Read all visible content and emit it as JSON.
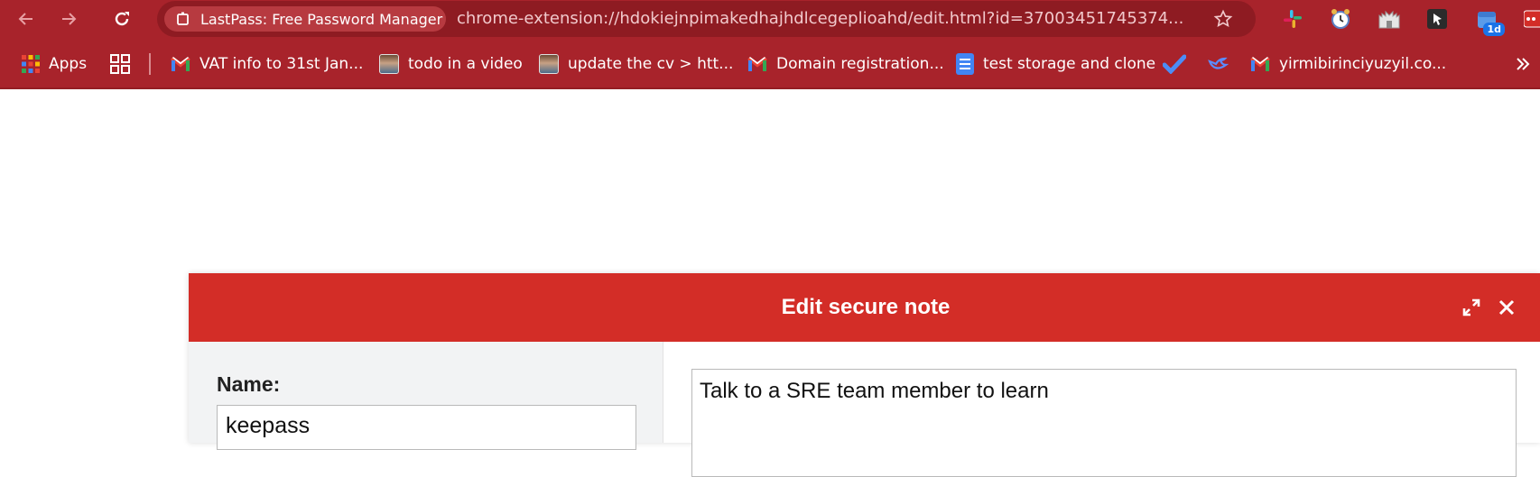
{
  "browser": {
    "site_chip_label": "LastPass: Free Password Manager",
    "url": "chrome-extension://hdokiejnpimakedhajhdlcegeplioahd/edit.html?id=37003451745374...",
    "extensions": [
      {
        "name": "slack-icon"
      },
      {
        "name": "alarm-clock-icon"
      },
      {
        "name": "castle-icon"
      },
      {
        "name": "cursor-arrow-icon"
      },
      {
        "name": "calendar-icon",
        "badge": "1d"
      },
      {
        "name": "lastpass-icon"
      }
    ],
    "accent_color": "#a8232b"
  },
  "bookmarks": {
    "apps_label": "Apps",
    "items": [
      {
        "icon": "gmail-icon",
        "label": "VAT info to 31st Jan..."
      },
      {
        "icon": "avatar-icon",
        "label": "todo in a video"
      },
      {
        "icon": "avatar-icon",
        "label": "update the cv > htt..."
      },
      {
        "icon": "gmail-icon",
        "label": "Domain registration..."
      },
      {
        "icon": "google-docs-icon",
        "label": "test storage and clone"
      },
      {
        "icon": "checkmark-icon",
        "label": ""
      },
      {
        "icon": "bird-icon",
        "label": ""
      },
      {
        "icon": "gmail-icon",
        "label": "yirmibirinciyuzyil.co..."
      }
    ],
    "overflow_icon": "double-chevron-right-icon"
  },
  "dialog": {
    "title": "Edit secure note",
    "header_color": "#d32d27",
    "name_label": "Name:",
    "name_value": "keepass",
    "notes_value": "Talk to a SRE team member to learn"
  }
}
